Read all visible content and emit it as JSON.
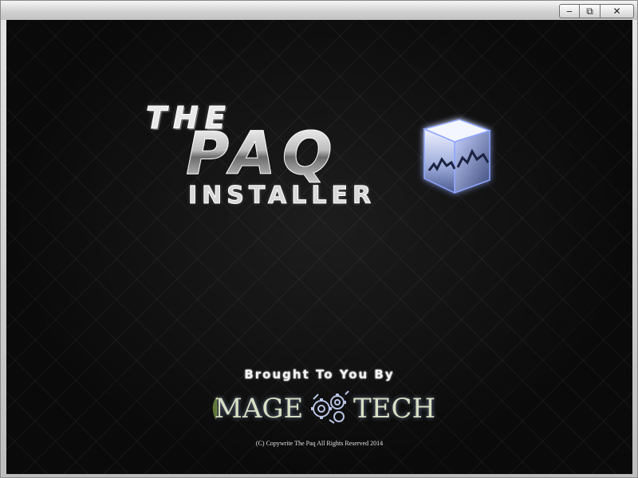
{
  "window": {
    "title": "",
    "controls": {
      "minimize_symbol": "‒",
      "restore_symbol": "⧉",
      "close_symbol": "✕"
    }
  },
  "splash": {
    "logo_the": "THE",
    "logo_name": "PAQ",
    "logo_sub": "INSTALLER",
    "brought_by": "Brought To You By",
    "brand_left": "MAGE",
    "brand_right": "TECH",
    "copyright": "(C) Copywrite The Paq All Rights Reserved 2014"
  },
  "colors": {
    "background": "#0a0a0a",
    "chrome": "#cfcfcf",
    "cube_glow": "#8fa6ff",
    "brand_text": "#d8dfc4"
  },
  "icons": {
    "cube": "cube-icon",
    "gear": "gear-icon",
    "leaf": "leaf-icon"
  }
}
